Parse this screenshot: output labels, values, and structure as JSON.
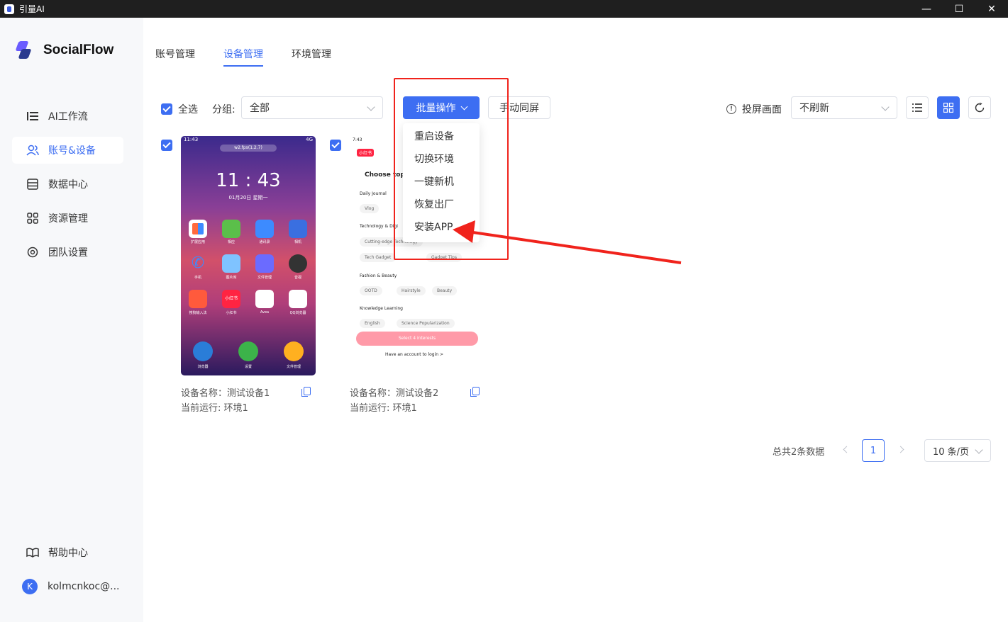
{
  "window": {
    "title": "引量AI",
    "controls": [
      "—",
      "☐",
      "✕"
    ]
  },
  "brand": {
    "name": "SocialFlow"
  },
  "sidebar": {
    "items": [
      {
        "label": "AI工作流",
        "icon": "list-tree-icon"
      },
      {
        "label": "账号&设备",
        "icon": "users-icon",
        "active": true
      },
      {
        "label": "数据中心",
        "icon": "database-icon"
      },
      {
        "label": "资源管理",
        "icon": "grid-icon"
      },
      {
        "label": "团队设置",
        "icon": "gear-icon"
      }
    ],
    "help": "帮助中心",
    "user": {
      "avatar": "K",
      "name": "kolmcnkoc@..."
    }
  },
  "tabs": [
    {
      "label": "账号管理"
    },
    {
      "label": "设备管理",
      "active": true
    },
    {
      "label": "环境管理"
    }
  ],
  "toolbar": {
    "select_all": "全选",
    "group_label": "分组:",
    "group_value": "全部",
    "batch_button": "批量操作",
    "sync_button": "手动同屏",
    "cast_label": "投屏画面",
    "refresh_value": "不刷新"
  },
  "batch_menu": {
    "items": [
      "重启设备",
      "切换环境",
      "一键新机",
      "恢复出厂",
      "安装APP"
    ]
  },
  "devices": [
    {
      "name_line": "设备名称：测试设备1",
      "env_line": "当前运行: 环境1",
      "screen": {
        "status_left": "11:43",
        "status_right": "4G",
        "pill": "w2.fps(1.2.7)",
        "time": "11 : 43",
        "date": "01月20日 星期一",
        "apps": [
          "扩展应用",
          "相应",
          "通讯录",
          "相机",
          "手机",
          "图片库",
          "文件管理",
          "音视",
          "搜狗输入法",
          "小红书",
          "Avea",
          "QQ浏览器",
          "浏览器",
          "设置",
          "文件管理"
        ]
      }
    },
    {
      "name_line": "设备名称：测试设备2",
      "env_line": "当前运行: 环境1",
      "screen": {
        "status": "7:43",
        "badge": "小红书",
        "title": "Choose top",
        "sections": [
          "Daily Journal",
          "Technology & Digi",
          "Fashion & Beauty",
          "Knowledge Learning"
        ],
        "chips": [
          "Vlog",
          "Cutting-edge Technology",
          "Tech Gadget",
          "Gadget Tips",
          "OOTD",
          "Hairstyle",
          "Beauty",
          "English",
          "Science Popularization"
        ],
        "cta": "Select 4 interests",
        "login": "Have an account to login >"
      }
    }
  ],
  "pagination": {
    "total": "总共2条数据",
    "current": "1",
    "page_size": "10 条/页"
  },
  "colors": {
    "accent": "#3d6ef2",
    "annotation": "#f0231c"
  }
}
